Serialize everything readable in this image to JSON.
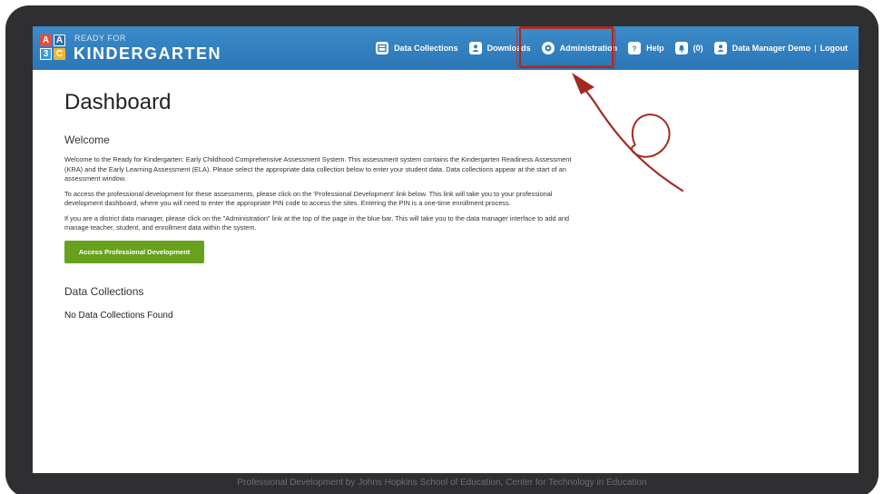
{
  "logo": {
    "block_letters": [
      "A",
      "A",
      "3",
      "C"
    ],
    "block_colors": [
      "#e74c3c",
      "#2c6fb0",
      "#3a9ad9",
      "#f2b632"
    ],
    "small_text": "READY FOR",
    "big_text": "KINDERGARTEN"
  },
  "nav": {
    "data_collections": "Data Collections",
    "downloads": "Downloads",
    "administration": "Administration",
    "help": "Help",
    "notifications": "(0)",
    "user": "Data Manager Demo",
    "separator": "|",
    "logout": "Logout",
    "icons": [
      "table-icon",
      "users-icon",
      "gear-icon",
      "question-icon",
      "bell-icon",
      "user-icon"
    ]
  },
  "main": {
    "title": "Dashboard",
    "welcome_heading": "Welcome",
    "paragraph1": "Welcome to the Ready for Kindergarten: Early Childhood Comprehensive Assessment System. This assessment system contains the Kindergarten Readiness Assessment (KRA) and the Early Learning Assessment (ELA). Please select the appropriate data collection below to enter your student data. Data collections appear at the start of an assessment window.",
    "paragraph2": "To access the professional development for these assessments, please click on the 'Professional Development' link below. This link will take you to your professional development dashboard, where you will need to enter the appropriate PIN code to access the sites. Entering the PIN is a one-time enrollment process.",
    "paragraph3": "If you are a district data manager, please click on the \"Administration\" link at the top of the page in the blue bar. This will take you to the data manager interface to add and manage teacher, student, and enrollment data within the system.",
    "button": "Access Professional Development",
    "data_collections_heading": "Data Collections",
    "no_data": "No Data Collections Found"
  },
  "footer": "Professional Development by Johns Hopkins School of Education, Center for Technology in Education",
  "colors": {
    "topbar": "#2f7fc0",
    "button_green": "#67a11d",
    "annotation_red": "#a32a23",
    "device_frame": "#2f2f31"
  }
}
